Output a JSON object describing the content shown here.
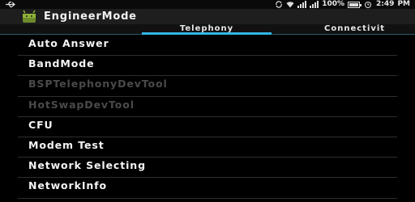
{
  "status_bar": {
    "battery_text": "100%",
    "time": "2:49",
    "time_suffix": "PM",
    "battery_level": 1.0
  },
  "action_bar": {
    "title": "EngineerMode",
    "icon": "android-icon"
  },
  "tabs": [
    {
      "label": "Telephony",
      "selected": true
    },
    {
      "label": "Connectivit",
      "selected": false
    }
  ],
  "list": [
    {
      "label": "Auto Answer",
      "enabled": true
    },
    {
      "label": "BandMode",
      "enabled": true
    },
    {
      "label": "BSPTelephonyDevTool",
      "enabled": false
    },
    {
      "label": "HotSwapDevTool",
      "enabled": false
    },
    {
      "label": "CFU",
      "enabled": true
    },
    {
      "label": "Modem Test",
      "enabled": true
    },
    {
      "label": "Network Selecting",
      "enabled": true
    },
    {
      "label": "NetworkInfo",
      "enabled": true
    }
  ],
  "colors": {
    "tab_indicator": "#33b5e5",
    "background": "#000000"
  }
}
